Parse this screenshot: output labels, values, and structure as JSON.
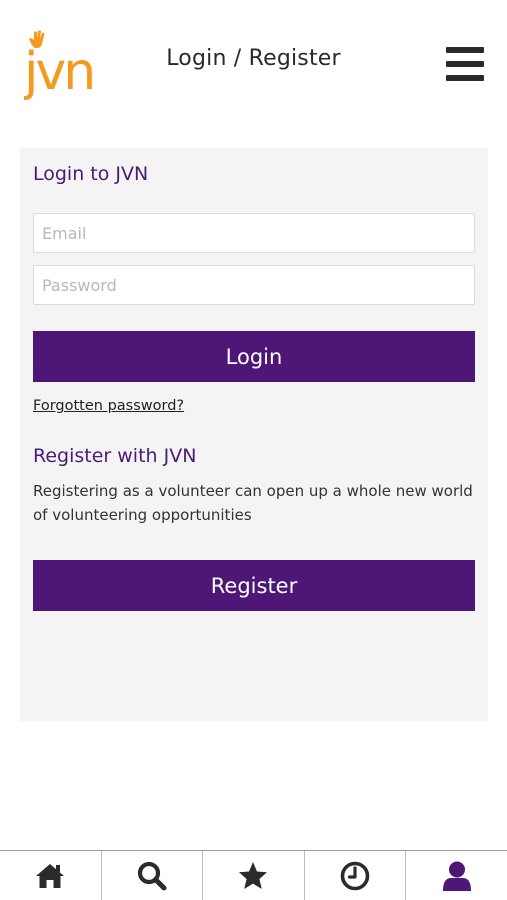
{
  "header": {
    "logo_text": "jvn",
    "title": "Login / Register",
    "menu_icon": "hamburger-menu-icon"
  },
  "login": {
    "heading": "Login to JVN",
    "email_placeholder": "Email",
    "password_placeholder": "Password",
    "login_label": "Login",
    "forgot_label": "Forgotten password?"
  },
  "register": {
    "heading": "Register with JVN",
    "description": "Registering as a volunteer can open up a whole new world of volunteering opportunities",
    "register_label": "Register"
  },
  "tabbar": {
    "items": [
      {
        "icon": "home-icon",
        "active": false
      },
      {
        "icon": "search-icon",
        "active": false
      },
      {
        "icon": "star-icon",
        "active": false
      },
      {
        "icon": "clock-icon",
        "active": false
      },
      {
        "icon": "user-icon",
        "active": true
      }
    ]
  },
  "colors": {
    "brand_orange": "#f39a1f",
    "brand_purple": "#4d1677",
    "heading_purple": "#4a1a78",
    "icon_dark": "#2b2b2b",
    "panel_bg": "#f4f4f4"
  }
}
